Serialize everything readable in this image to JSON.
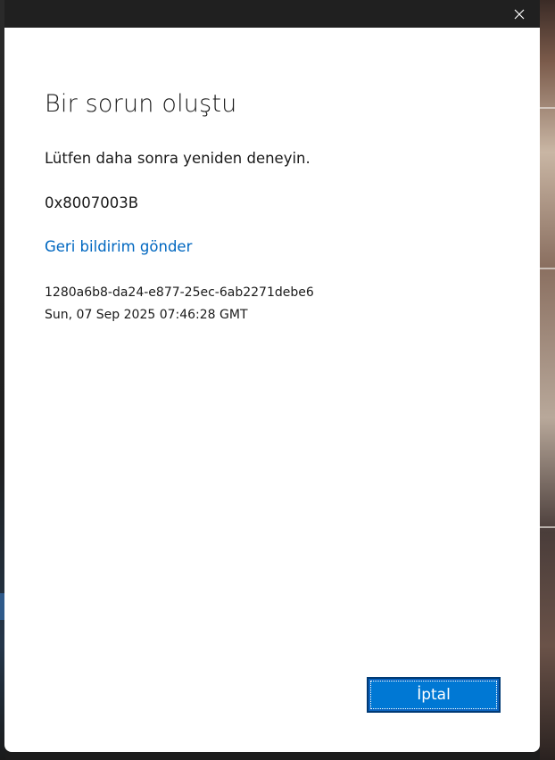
{
  "dialog": {
    "title": "Bir sorun oluştu",
    "message": "Lütfen daha sonra yeniden deneyin.",
    "error_code": "0x8007003B",
    "feedback_link": "Geri bildirim gönder",
    "correlation_id": "1280a6b8-da24-e877-25ec-6ab2271debe6",
    "timestamp": "Sun, 07 Sep 2025 07:46:28 GMT",
    "cancel_label": "İptal"
  },
  "titlebar": {
    "close_icon": "close-icon"
  },
  "colors": {
    "link": "#0067c0",
    "primary_button": "#0078d4",
    "titlebar": "#202020",
    "dialog_bg": "#ffffff"
  }
}
